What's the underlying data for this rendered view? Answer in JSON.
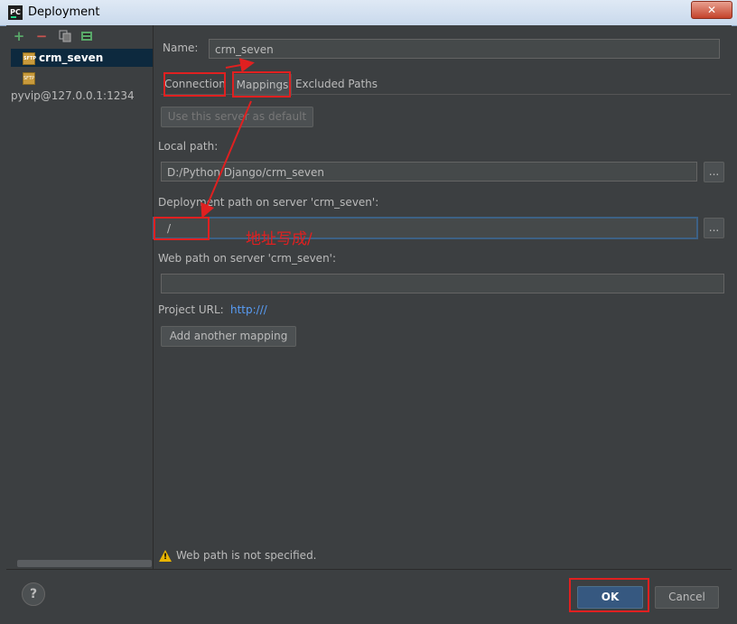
{
  "window": {
    "title": "Deployment",
    "app_icon_text": "PC",
    "close_symbol": "✕"
  },
  "toolbar": {
    "add_symbol": "+",
    "remove_symbol": "−"
  },
  "servers": [
    {
      "name": "crm_seven",
      "selected": true
    },
    {
      "name": "pyvip@127.0.0.1:1234",
      "selected": false
    }
  ],
  "form": {
    "name_label": "Name:",
    "name_value": "crm_seven"
  },
  "tabs": [
    {
      "label": "Connection",
      "active": false
    },
    {
      "label": "Mappings",
      "active": true
    },
    {
      "label": "Excluded Paths",
      "active": false
    }
  ],
  "mappings": {
    "default_button": "Use this server as default",
    "local_path_label": "Local path:",
    "local_path_value": "D:/Python Django/crm_seven",
    "deployment_path_label": "Deployment path on server 'crm_seven':",
    "deployment_path_value": "/",
    "web_path_label": "Web path on server 'crm_seven':",
    "web_path_value": "",
    "project_url_label": "Project URL:",
    "project_url_value": "http:///",
    "add_mapping_button": "Add another mapping",
    "browse_symbol": "..."
  },
  "warning": {
    "text": "Web path is not specified.",
    "icon_glyph": "!"
  },
  "buttons": {
    "help": "?",
    "ok": "OK",
    "cancel": "Cancel"
  },
  "annotation": {
    "text": "地址写成/"
  }
}
